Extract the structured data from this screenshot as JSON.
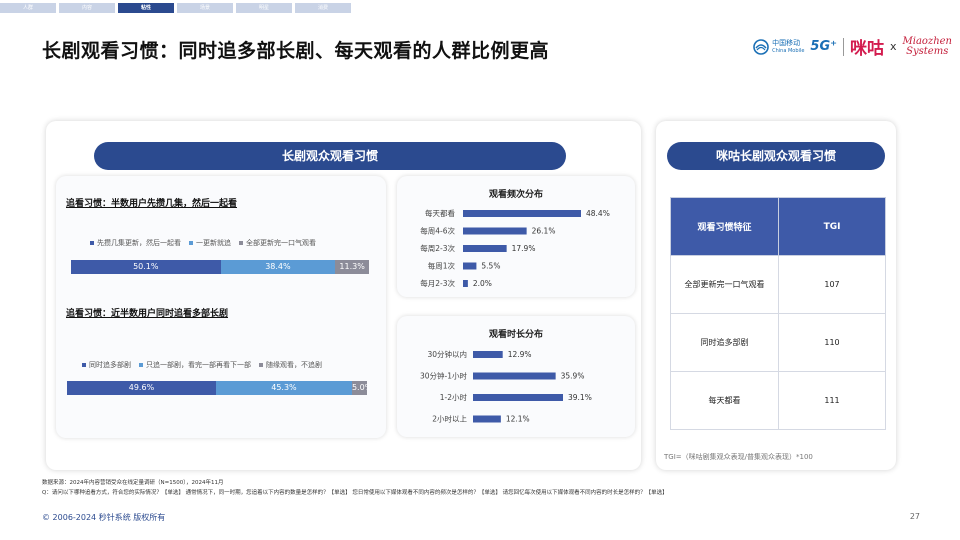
{
  "nav": [
    "人群",
    "内容",
    "粘性",
    "场景",
    "明星",
    "消费"
  ],
  "nav_active": 2,
  "title": "长剧观看习惯：同时追多部长剧、每天观看的人群比例更高",
  "logos": {
    "china_mobile_cn": "中国移动",
    "china_mobile_en": "China Mobile",
    "fiveg": "5G⁺",
    "migu": "咪咕",
    "times": "x",
    "miaozhen_line1": "Miaozhen",
    "miaozhen_line2": "Systems"
  },
  "left_panel_title": "长剧观众观看习惯",
  "right_panel_title": "咪咕长剧观众观看习惯",
  "chart_data": [
    {
      "type": "bar",
      "stacked": true,
      "orientation": "horizontal",
      "title": "追看习惯：半数用户先攒几集，然后一起看",
      "series": [
        {
          "name": "先攒几集更新，然后一起看",
          "values": [
            50.1
          ],
          "labels": [
            "50.1%"
          ],
          "color": "#3e5aa8"
        },
        {
          "name": "一更新就追",
          "values": [
            38.4
          ],
          "labels": [
            "38.4%"
          ],
          "color": "#5b9bd5"
        },
        {
          "name": "全部更新完一口气观看",
          "values": [
            11.3
          ],
          "labels": [
            "11.3%"
          ],
          "color": "#8c8c99"
        }
      ]
    },
    {
      "type": "bar",
      "stacked": true,
      "orientation": "horizontal",
      "title": "追看习惯：近半数用户同时追看多部长剧",
      "series": [
        {
          "name": "同时追多部剧",
          "values": [
            49.6
          ],
          "labels": [
            "49.6%"
          ],
          "color": "#3e5aa8"
        },
        {
          "name": "只追一部剧，看完一部再看下一部",
          "values": [
            45.3
          ],
          "labels": [
            "45.3%"
          ],
          "color": "#5b9bd5"
        },
        {
          "name": "随缘观看，不追剧",
          "values": [
            5.0
          ],
          "labels": [
            "5.0%"
          ],
          "color": "#8c8c99"
        }
      ]
    },
    {
      "type": "bar",
      "orientation": "horizontal",
      "title": "观看频次分布",
      "categories": [
        "每天都看",
        "每周4-6次",
        "每周2-3次",
        "每周1次",
        "每月2-3次"
      ],
      "values": [
        48.4,
        26.1,
        17.9,
        5.5,
        2.0
      ],
      "labels": [
        "48.4%",
        "26.1%",
        "17.9%",
        "5.5%",
        "2.0%"
      ],
      "color": "#3e5aa8"
    },
    {
      "type": "bar",
      "orientation": "horizontal",
      "title": "观看时长分布",
      "categories": [
        "30分钟以内",
        "30分钟-1小时",
        "1-2小时",
        "2小时以上"
      ],
      "values": [
        12.9,
        35.9,
        39.1,
        12.1
      ],
      "labels": [
        "12.9%",
        "35.9%",
        "39.1%",
        "12.1%"
      ],
      "color": "#3e5aa8"
    },
    {
      "type": "table",
      "columns": [
        "观看习惯特征",
        "TGI"
      ],
      "rows": [
        [
          "全部更新完一口气观看",
          "107"
        ],
        [
          "同时追多部剧",
          "110"
        ],
        [
          "每天都看",
          "111"
        ]
      ]
    }
  ],
  "tgi_note": "TGI=（咪咕剧集观众表现/普集观众表现）*100",
  "source_line1": "数据来源：2024年内容营销受众在线定量调研（N=1500），2024年11月",
  "source_line2": "Q：请问以下哪种追看方式，符合您的实际情况？【单选】 通常情况下，同一时期，您追着以下内容的数量是怎样的？【单选】 您日常使用以下媒体观看不同内容的频次是怎样的？【单选】 请您回忆每次使用以下媒体观看不同内容的时长是怎样的？【单选】",
  "copyright": "© 2006-2024 秒针系统 版权所有",
  "page_number": "27"
}
